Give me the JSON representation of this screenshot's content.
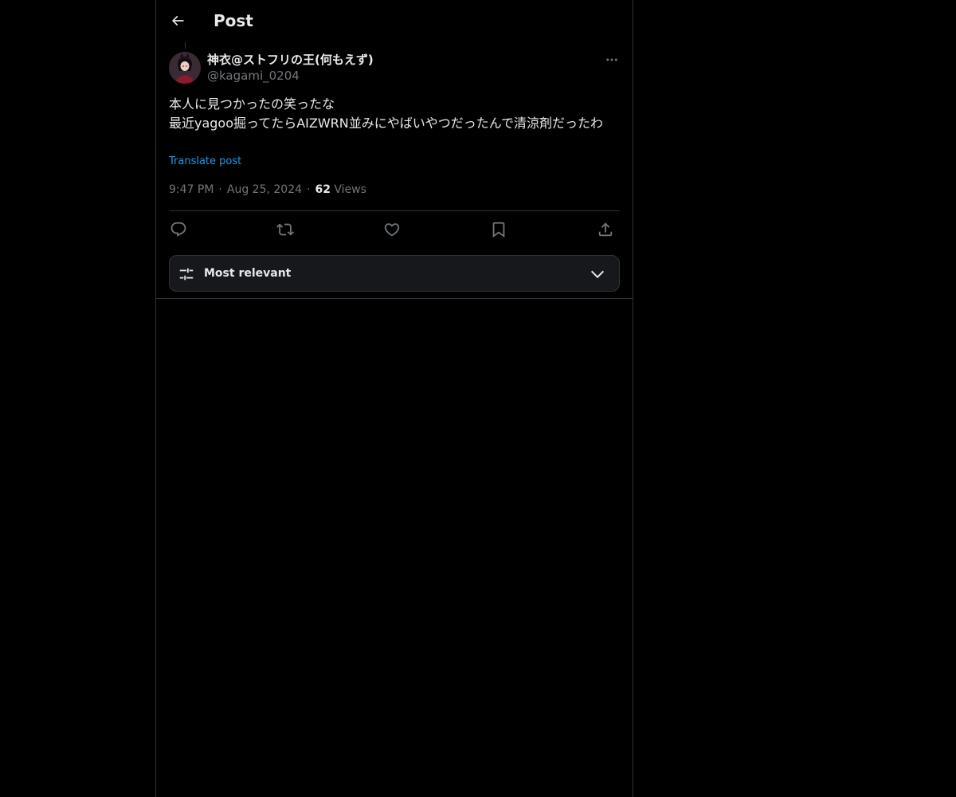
{
  "header": {
    "title": "Post",
    "back_icon": "arrow-left-icon"
  },
  "author": {
    "display_name": "神衣@ストフリの王(何もえず)",
    "handle": "@kagami_0204",
    "avatar_icon": "avatar-image"
  },
  "post": {
    "lines": [
      "本人に見つかったの笑ったな",
      "最近yagoo掘ってたらAIZWRN並みにやばいやつだったんで清涼剤だったわ"
    ],
    "translate_label": "Translate post",
    "time": "9:47 PM",
    "date": "Aug 25, 2024",
    "views_count": "62",
    "views_label": "Views"
  },
  "actions": {
    "reply_icon": "reply-icon",
    "repost_icon": "repost-icon",
    "like_icon": "heart-icon",
    "bookmark_icon": "bookmark-icon",
    "share_icon": "share-icon"
  },
  "replies_sort": {
    "label": "Most relevant",
    "icon": "sliders-icon",
    "chevron": "chevron-down-icon"
  },
  "colors": {
    "background": "#000000",
    "text_primary": "#e7e9ea",
    "text_secondary": "#71767b",
    "accent": "#1d9bf0",
    "border": "#2f3336"
  }
}
